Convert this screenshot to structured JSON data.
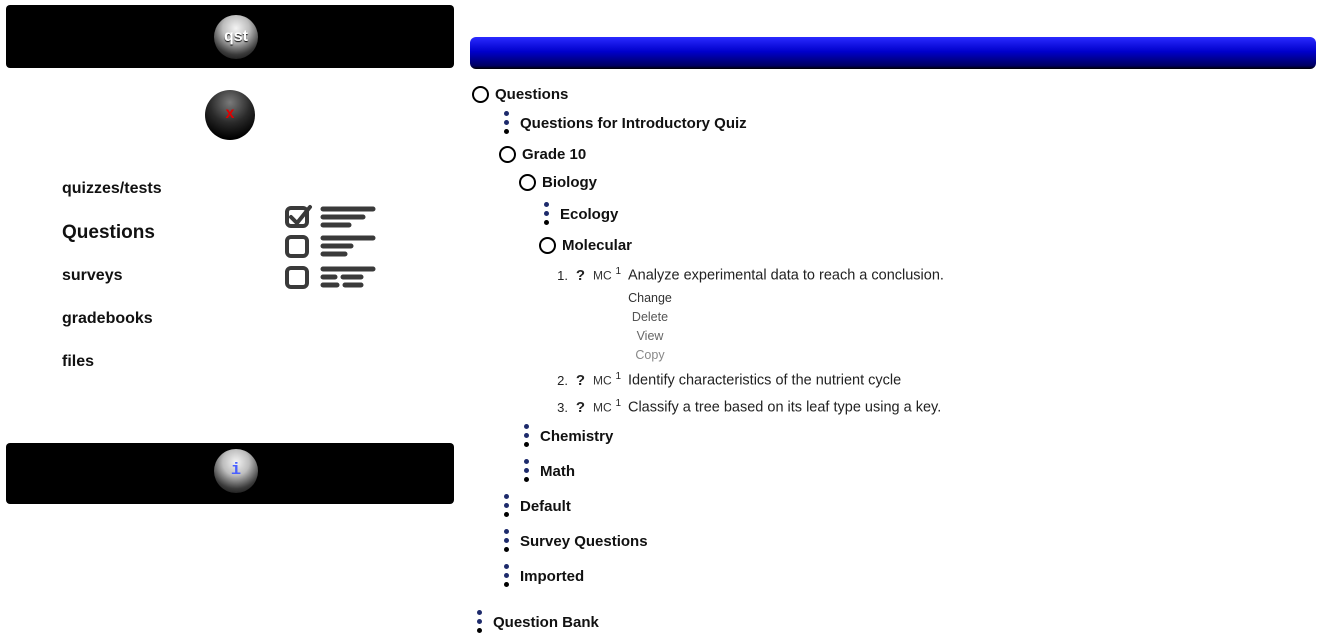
{
  "app": {
    "logo_label": "qst",
    "close_label": "x",
    "info_label": "i"
  },
  "nav": {
    "items": [
      {
        "label": "quizzes/tests"
      },
      {
        "label": "Questions"
      },
      {
        "label": "surveys"
      },
      {
        "label": "gradebooks"
      },
      {
        "label": "files"
      }
    ]
  },
  "tree": {
    "root": "Questions",
    "intro": "Questions for Introductory Quiz",
    "grade10": "Grade 10",
    "biology": "Biology",
    "ecology": "Ecology",
    "molecular": "Molecular",
    "chemistry": "Chemistry",
    "math": "Math",
    "default": "Default",
    "survey_questions": "Survey Questions",
    "imported": "Imported",
    "question_bank": "Question Bank"
  },
  "questions": [
    {
      "num": "1.",
      "mark": "?",
      "type": "MC",
      "points": "1",
      "text": "Analyze experimental data to reach a conclusion."
    },
    {
      "num": "2.",
      "mark": "?",
      "type": "MC",
      "points": "1",
      "text": "Identify characteristics of the nutrient cycle"
    },
    {
      "num": "3.",
      "mark": "?",
      "type": "MC",
      "points": "1",
      "text": "Classify a tree based on its leaf type using a key."
    }
  ],
  "actions": {
    "change": "Change",
    "delete": "Delete",
    "view": "View",
    "copy": "Copy"
  },
  "colors": {
    "header_blue": "#0000cc",
    "dots_blue": "#1d2a6b",
    "close_red": "#e00000"
  }
}
